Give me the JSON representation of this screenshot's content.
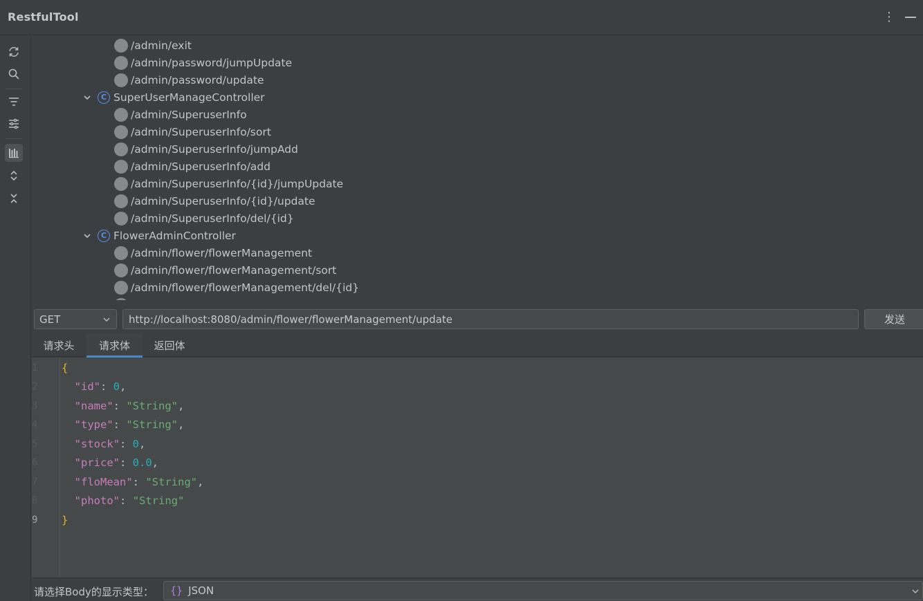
{
  "window": {
    "title": "RestfulTool"
  },
  "toolbar": {
    "icons": [
      "refresh-icon",
      "search-icon",
      "filter-icon",
      "settings-icon",
      "columns-icon",
      "expand-icon",
      "collapse-icon"
    ]
  },
  "tree": {
    "rows": [
      {
        "kind": "endpoint",
        "label": "/admin/exit"
      },
      {
        "kind": "endpoint",
        "label": "/admin/password/jumpUpdate"
      },
      {
        "kind": "endpoint",
        "label": "/admin/password/update"
      },
      {
        "kind": "controller",
        "label": "SuperUserManageController",
        "icon_text": "C"
      },
      {
        "kind": "endpoint",
        "label": "/admin/SuperuserInfo"
      },
      {
        "kind": "endpoint",
        "label": "/admin/SuperuserInfo/sort"
      },
      {
        "kind": "endpoint",
        "label": "/admin/SuperuserInfo/jumpAdd"
      },
      {
        "kind": "endpoint",
        "label": "/admin/SuperuserInfo/add"
      },
      {
        "kind": "endpoint",
        "label": "/admin/SuperuserInfo/{id}/jumpUpdate"
      },
      {
        "kind": "endpoint",
        "label": "/admin/SuperuserInfo/{id}/update"
      },
      {
        "kind": "endpoint",
        "label": "/admin/SuperuserInfo/del/{id}"
      },
      {
        "kind": "controller",
        "label": "FlowerAdminController",
        "icon_text": "C"
      },
      {
        "kind": "endpoint",
        "label": "/admin/flower/flowerManagement"
      },
      {
        "kind": "endpoint",
        "label": "/admin/flower/flowerManagement/sort"
      },
      {
        "kind": "endpoint",
        "label": "/admin/flower/flowerManagement/del/{id}"
      }
    ]
  },
  "request": {
    "method": "GET",
    "url": "http://localhost:8080/admin/flower/flowerManagement/update",
    "send_label": "发送"
  },
  "tabs": [
    {
      "label": "请求头",
      "active": false
    },
    {
      "label": "请求体",
      "active": true
    },
    {
      "label": "返回体",
      "active": false
    }
  ],
  "editor": {
    "line_numbers": [
      "1",
      "2",
      "3",
      "4",
      "5",
      "6",
      "7",
      "8",
      "9"
    ],
    "current_line": "9",
    "open_brace": "{",
    "close_brace": "}",
    "fields": [
      {
        "key": "\"id\"",
        "value": "0",
        "vtype": "n",
        "comma": ","
      },
      {
        "key": "\"name\"",
        "value": "\"String\"",
        "vtype": "s",
        "comma": ","
      },
      {
        "key": "\"type\"",
        "value": "\"String\"",
        "vtype": "s",
        "comma": ","
      },
      {
        "key": "\"stock\"",
        "value": "0",
        "vtype": "n",
        "comma": ","
      },
      {
        "key": "\"price\"",
        "value": "0.0",
        "vtype": "n",
        "comma": ","
      },
      {
        "key": "\"floMean\"",
        "value": "\"String\"",
        "vtype": "s",
        "comma": ","
      },
      {
        "key": "\"photo\"",
        "value": "\"String\"",
        "vtype": "s",
        "comma": ""
      }
    ]
  },
  "footer": {
    "label": "请选择Body的显示类型：",
    "body_type": "JSON",
    "body_type_icon": "{}"
  },
  "colors": {
    "accent": "#4a88c7",
    "key": "#c77dbb",
    "string": "#6aab73",
    "number": "#2aacb8",
    "brace": "#e6b422"
  }
}
